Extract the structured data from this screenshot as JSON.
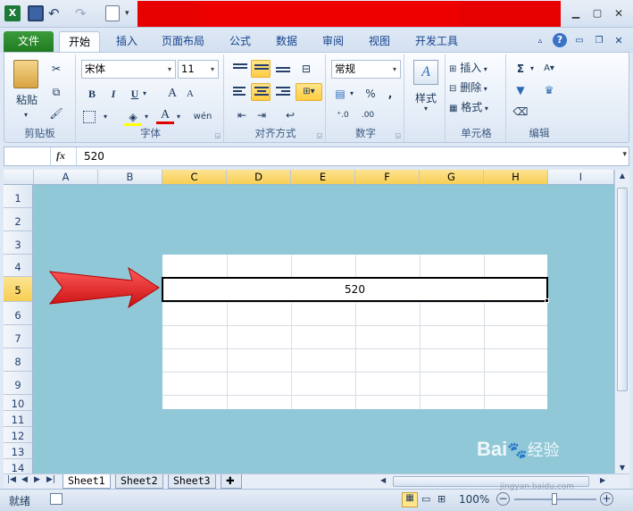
{
  "ribbon_tabs": [
    "文件",
    "开始",
    "插入",
    "页面布局",
    "公式",
    "数据",
    "审阅",
    "视图",
    "开发工具"
  ],
  "clipboard": {
    "paste_label": "粘贴",
    "group_label": "剪贴板"
  },
  "font": {
    "name": "宋体",
    "size": "11",
    "group_label": "字体",
    "bold": "B",
    "italic": "I",
    "underline": "U",
    "grow": "A",
    "shrink": "A",
    "font_color": "A",
    "phonetic": "wén"
  },
  "alignment": {
    "group_label": "对齐方式"
  },
  "number": {
    "format": "常规",
    "percent": "%",
    "comma": ",",
    "group_label": "数字"
  },
  "styles": {
    "label": "样式"
  },
  "cells": {
    "insert": "插入",
    "delete": "删除",
    "format": "格式",
    "group_label": "单元格"
  },
  "editing": {
    "sigma": "Σ",
    "group_label": "编辑"
  },
  "formula_bar": {
    "fx": "fx",
    "value": "520"
  },
  "columns": [
    "A",
    "B",
    "C",
    "D",
    "E",
    "F",
    "G",
    "H",
    "I"
  ],
  "rows": [
    "1",
    "2",
    "3",
    "4",
    "5",
    "6",
    "7",
    "8",
    "9",
    "10",
    "11",
    "12",
    "13",
    "14"
  ],
  "active_cell_value": "520",
  "sheets": [
    "Sheet1",
    "Sheet2",
    "Sheet3"
  ],
  "status": {
    "ready": "就绪",
    "zoom": "100%"
  },
  "watermark": {
    "brand": "Bai",
    "brand2": "经验",
    "url": "jingyan.baidu.com"
  },
  "colors": {
    "title_red": "#e60000",
    "grid_bg": "#90c8d8",
    "file_tab": "#1f7a1f",
    "arrow": "#e8262a"
  }
}
